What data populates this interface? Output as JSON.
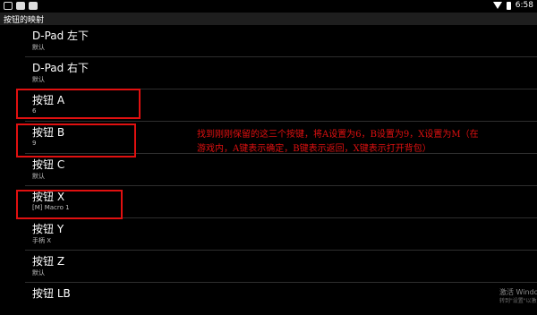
{
  "status_bar": {
    "time": "6:58"
  },
  "title_bar": {
    "title": "按钮的映射"
  },
  "list": {
    "items": [
      {
        "title": "D-Pad 左下",
        "subtitle": "默认"
      },
      {
        "title": "D-Pad 右下",
        "subtitle": "默认"
      },
      {
        "title": "按钮 A",
        "subtitle": "6"
      },
      {
        "title": "按钮 B",
        "subtitle": "9"
      },
      {
        "title": "按钮 C",
        "subtitle": "默认"
      },
      {
        "title": "按钮 X",
        "subtitle": "[M] Macro 1"
      },
      {
        "title": "按钮 Y",
        "subtitle": "手柄 X"
      },
      {
        "title": "按钮 Z",
        "subtitle": "默认"
      },
      {
        "title": "按钮 LB",
        "subtitle": ""
      }
    ]
  },
  "annotation": {
    "text": "找到刚刚保留的这三个按键，将A设置为6，B设置为9，X设置为M（在游戏内，A键表示确定，B键表示返回，X键表示打开背包）",
    "color": "#e01010"
  },
  "watermark": {
    "line1": "激活 Windo",
    "line2": "转到\"设置\"以激"
  },
  "colors": {
    "background": "#000000",
    "title_bar": "#1e1e1e",
    "highlight": "#e01010"
  }
}
